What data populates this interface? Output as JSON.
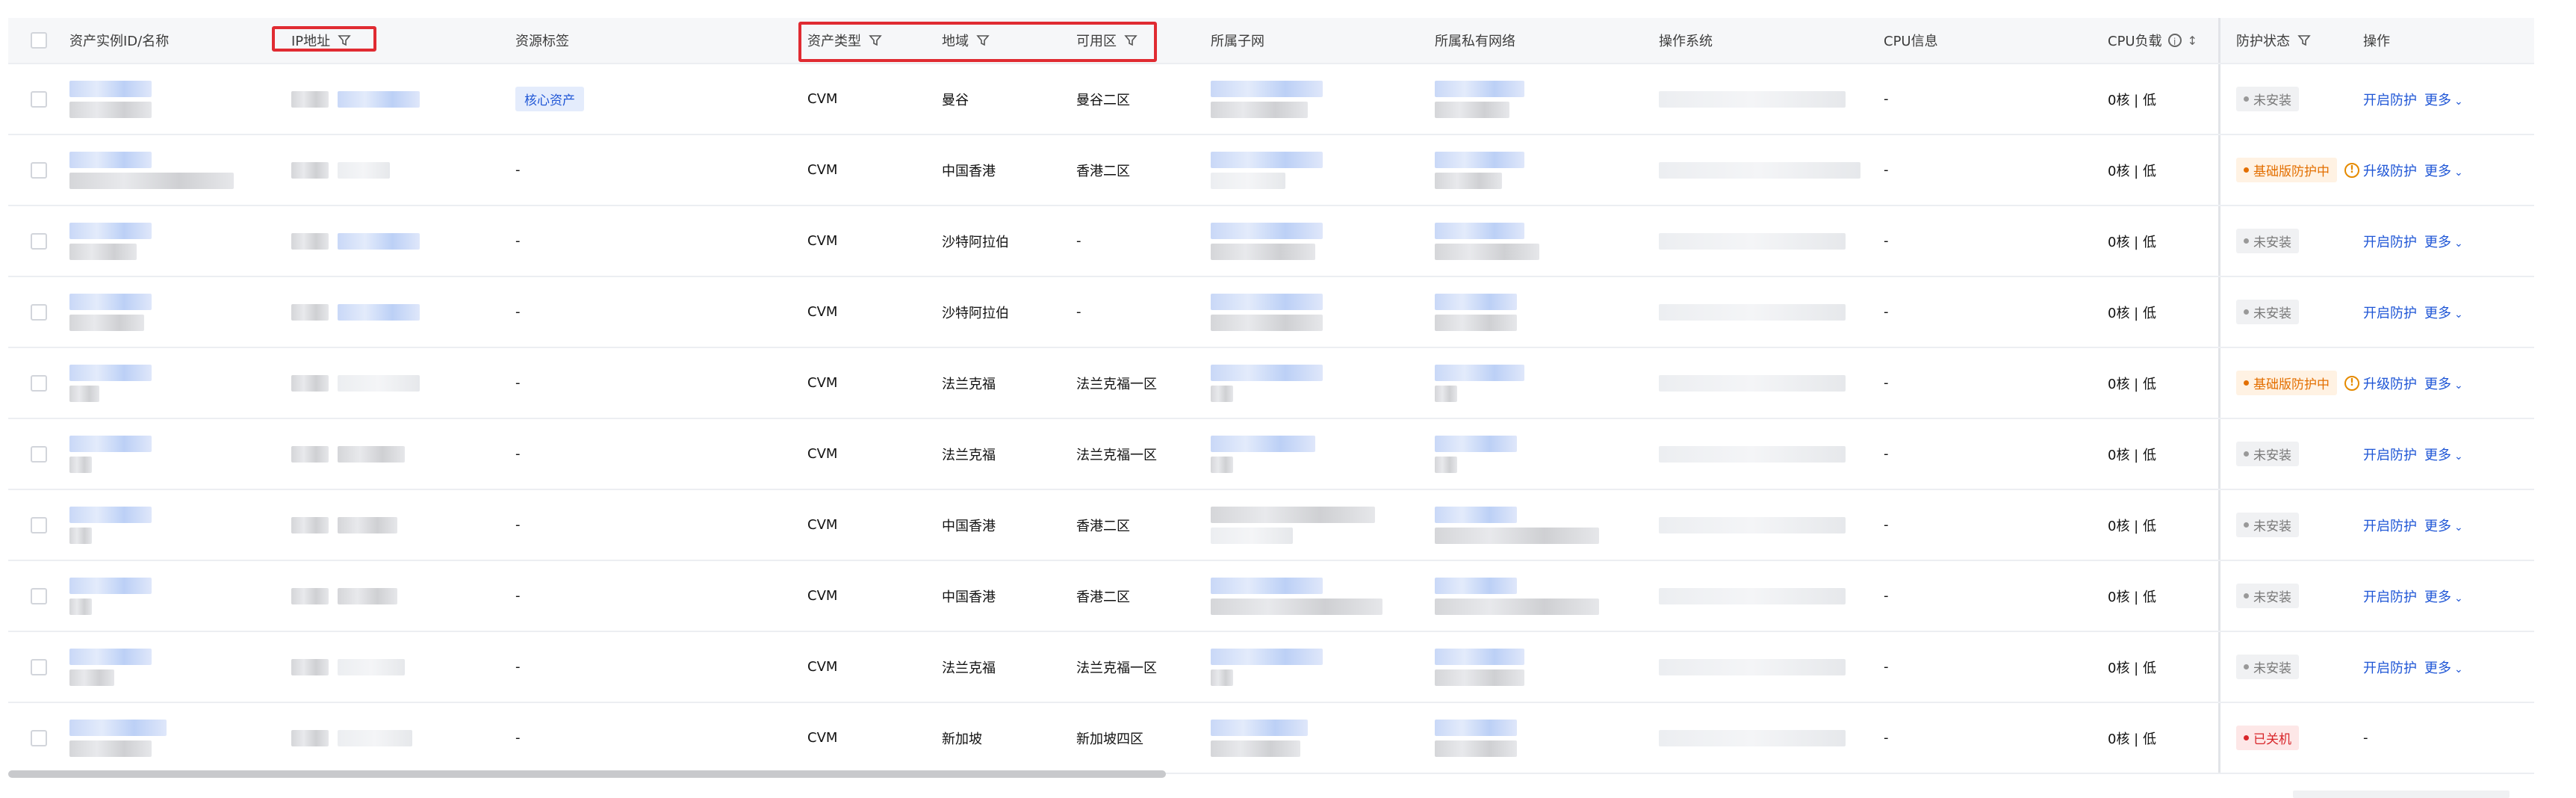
{
  "table": {
    "headers": {
      "id": "资产实例ID/名称",
      "ip": "IP地址",
      "tag": "资源标签",
      "type": "资产类型",
      "region": "地域",
      "zone": "可用区",
      "subnet": "所属子网",
      "vpc": "所属私有网络",
      "os": "操作系统",
      "cpuinfo": "CPU信息",
      "cpuload": "CPU负载",
      "status": "防护状态",
      "op": "操作"
    },
    "rows": [
      {
        "tag": "核心资产",
        "type": "CVM",
        "region": "曼谷",
        "zone": "曼谷二区",
        "cpuinfo": "-",
        "cpuload": "0核 | 低",
        "status": "未安装",
        "status_kind": "gray",
        "op": "开启防护",
        "more": "更多"
      },
      {
        "tag": "-",
        "type": "CVM",
        "region": "中国香港",
        "zone": "香港二区",
        "cpuinfo": "-",
        "cpuload": "0核 | 低",
        "status": "基础版防护中",
        "status_kind": "orange",
        "op": "升级防护",
        "more": "更多"
      },
      {
        "tag": "-",
        "type": "CVM",
        "region": "沙特阿拉伯",
        "zone": "-",
        "cpuinfo": "-",
        "cpuload": "0核 | 低",
        "status": "未安装",
        "status_kind": "gray",
        "op": "开启防护",
        "more": "更多"
      },
      {
        "tag": "-",
        "type": "CVM",
        "region": "沙特阿拉伯",
        "zone": "-",
        "cpuinfo": "-",
        "cpuload": "0核 | 低",
        "status": "未安装",
        "status_kind": "gray",
        "op": "开启防护",
        "more": "更多"
      },
      {
        "tag": "-",
        "type": "CVM",
        "region": "法兰克福",
        "zone": "法兰克福一区",
        "cpuinfo": "-",
        "cpuload": "0核 | 低",
        "status": "基础版防护中",
        "status_kind": "orange",
        "op": "升级防护",
        "more": "更多"
      },
      {
        "tag": "-",
        "type": "CVM",
        "region": "法兰克福",
        "zone": "法兰克福一区",
        "cpuinfo": "-",
        "cpuload": "0核 | 低",
        "status": "未安装",
        "status_kind": "gray",
        "op": "开启防护",
        "more": "更多"
      },
      {
        "tag": "-",
        "type": "CVM",
        "region": "中国香港",
        "zone": "香港二区",
        "cpuinfo": "-",
        "cpuload": "0核 | 低",
        "status": "未安装",
        "status_kind": "gray",
        "op": "开启防护",
        "more": "更多"
      },
      {
        "tag": "-",
        "type": "CVM",
        "region": "中国香港",
        "zone": "香港二区",
        "cpuinfo": "-",
        "cpuload": "0核 | 低",
        "status": "未安装",
        "status_kind": "gray",
        "op": "开启防护",
        "more": "更多"
      },
      {
        "tag": "-",
        "type": "CVM",
        "region": "法兰克福",
        "zone": "法兰克福一区",
        "cpuinfo": "-",
        "cpuload": "0核 | 低",
        "status": "未安装",
        "status_kind": "gray",
        "op": "开启防护",
        "more": "更多"
      },
      {
        "tag": "-",
        "type": "CVM",
        "region": "新加坡",
        "zone": "新加坡四区",
        "cpuinfo": "-",
        "cpuload": "0核 | 低",
        "status": "已关机",
        "status_kind": "red",
        "op": "-",
        "more": ""
      }
    ]
  },
  "colors": {
    "accent": "#1f56d6",
    "highlight_box": "#e02b32",
    "status_orange": "#e36f00",
    "status_red": "#d8262a"
  },
  "icons": {
    "filter": "filter-icon",
    "sort": "sort-icon",
    "info": "info-icon",
    "warning": "warning-icon",
    "chevron": "chevron-down-icon"
  }
}
